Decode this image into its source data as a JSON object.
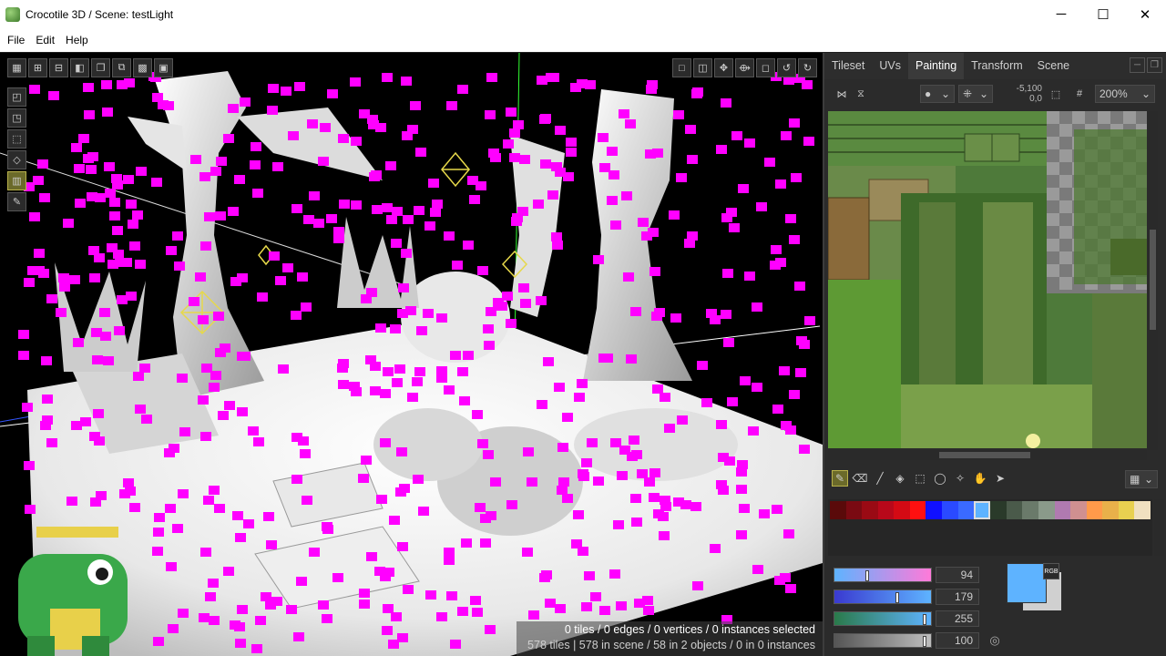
{
  "window": {
    "title": "Crocotile 3D / Scene: testLight"
  },
  "window_controls": {
    "minimize": "─",
    "maximize": "☐",
    "close": "✕"
  },
  "menu": [
    "File",
    "Edit",
    "Help"
  ],
  "viewport": {
    "status_line1": "0 tiles / 0 edges / 0 vertices / 0 instances selected",
    "status_line2": "578 tiles | 578 in scene / 58 in 2 objects / 0 in 0 instances"
  },
  "panel": {
    "tabs": [
      "Tileset",
      "UVs",
      "Painting",
      "Transform",
      "Scene"
    ],
    "active_tab": "Painting",
    "coords": [
      "-5,100",
      "0,0"
    ],
    "zoom": "200%"
  },
  "palette": {
    "colors": [
      "#5a0a0a",
      "#7a0a12",
      "#9a0a14",
      "#b8081a",
      "#d40a14",
      "#ff1010",
      "#1010ff",
      "#2a4aff",
      "#3a6aff",
      "#5eb3ff",
      "#2a3a2a",
      "#4a5a4a",
      "#6a7a6a",
      "#8a9a8a",
      "#b07ab0",
      "#d09090",
      "#ff9a4a",
      "#e8b04a",
      "#e8d050",
      "#f0e0c0"
    ],
    "selected_index": 9
  },
  "sliders": [
    {
      "value": "94",
      "fraction": 0.37
    },
    {
      "value": "179",
      "fraction": 0.7
    },
    {
      "value": "255",
      "fraction": 1.0
    },
    {
      "value": "100",
      "fraction": 1.0
    }
  ],
  "rgb_label": "RGB",
  "colors": {
    "accent": "#5eb3ff",
    "vertex": "#ff00ff",
    "active_tool": "#6b6a2a"
  }
}
